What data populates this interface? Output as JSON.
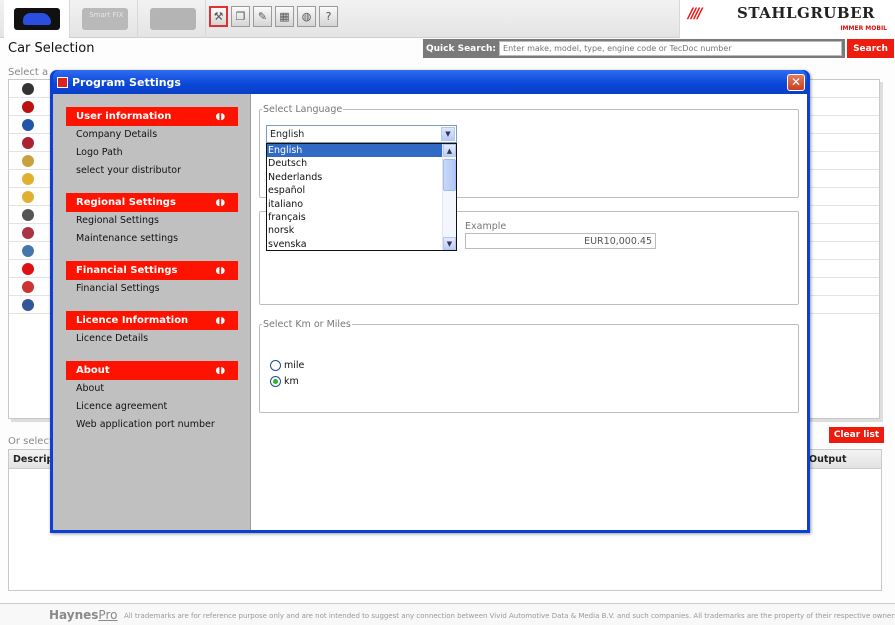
{
  "topbar": {
    "app_tabs": [
      {
        "name": "car",
        "label": ""
      },
      {
        "name": "smartfix",
        "label": "Smart FIX"
      },
      {
        "name": "truck",
        "label": ""
      }
    ],
    "toolbar_icons": [
      "settings-icon",
      "copy-icon",
      "edit-icon",
      "calculator-icon",
      "globe-icon",
      "help-icon"
    ],
    "toolbar_glyphs": [
      "⚒",
      "❐",
      "✎",
      "▦",
      "◍",
      "?"
    ],
    "brand": {
      "stripes": "////",
      "name": "STAHLGRUBER",
      "tagline": "IMMER MOBIL"
    }
  },
  "page_title": "Car Selection",
  "quick_search": {
    "label": "Quick Search:",
    "placeholder": "Enter make, model, type, engine code or TecDoc number",
    "button": "Search"
  },
  "select_label": "Select a",
  "brand_rows": [
    "#333",
    "#bb1111",
    "#2255aa",
    "#aa2233",
    "#c8a040",
    "#e0b030",
    "#e0b030",
    "#555555",
    "#aa3344",
    "#4477aa",
    "#dd1111",
    "#cc3333",
    "#335599"
  ],
  "or_select_label": "Or select",
  "clear_list": "Clear list",
  "results": {
    "col_left": "Descrip",
    "col_right": "Output"
  },
  "footer": {
    "logo_bold": "Haynes",
    "logo_light": "Pro",
    "text": "All trademarks are for reference purpose only and are not intended to suggest any connection between Vivid Automotive Data & Media B.V. and such companies. All trademarks are the property of their respective owners"
  },
  "dialog": {
    "title": "Program Settings",
    "close": "✕",
    "sections": [
      {
        "header": "User information",
        "items": [
          "Company Details",
          "Logo Path",
          "select your distributor"
        ]
      },
      {
        "header": "Regional Settings",
        "items": [
          "Regional Settings",
          "Maintenance settings"
        ]
      },
      {
        "header": "Financial Settings",
        "items": [
          "Financial Settings"
        ]
      },
      {
        "header": "Licence Information",
        "items": [
          "Licence Details"
        ]
      },
      {
        "header": "About",
        "items": [
          "About",
          "Licence agreement",
          "Web application port number"
        ]
      }
    ],
    "language": {
      "legend": "Select Language",
      "selected": "English",
      "options": [
        "English",
        "Deutsch",
        "Nederlands",
        "español",
        "italiano",
        "français",
        "norsk",
        "svenska"
      ]
    },
    "currency": {
      "example_label": "Example",
      "example_value": "EUR10,000.45"
    },
    "distance": {
      "legend": "Select Km or Miles",
      "options": [
        {
          "label": "mile",
          "checked": false
        },
        {
          "label": "km",
          "checked": true
        }
      ]
    }
  }
}
